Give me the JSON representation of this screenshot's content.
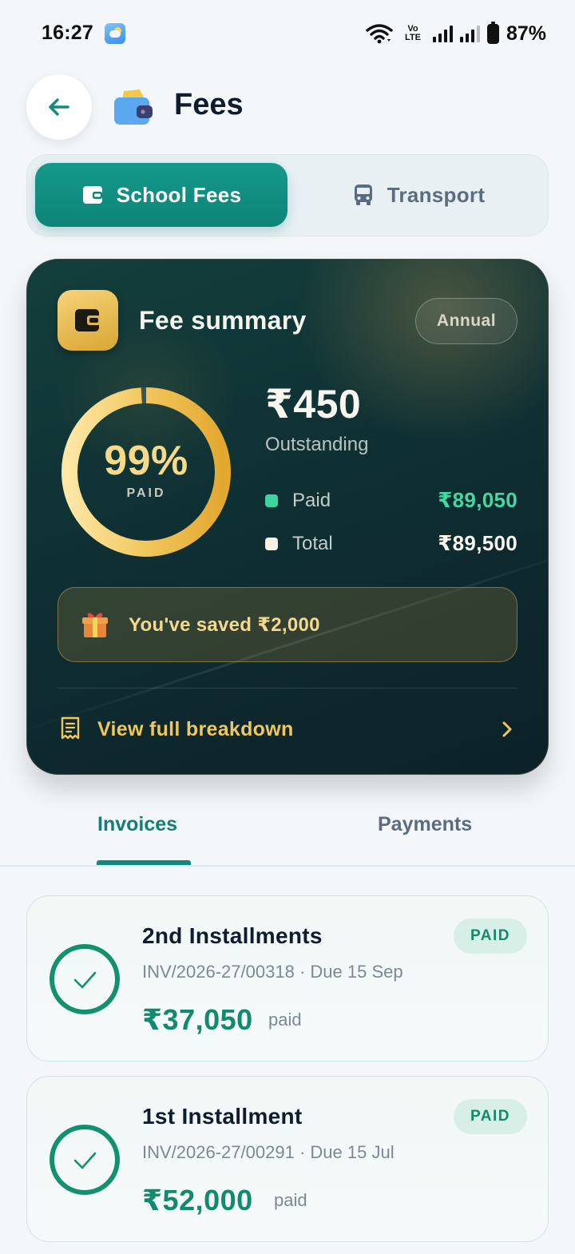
{
  "status_bar": {
    "time": "16:27",
    "network_label_top": "Vo",
    "network_label_bottom": "LTE",
    "battery": "87%"
  },
  "header": {
    "title": "Fees",
    "back_icon": "arrow-left-icon",
    "title_icon": "wallet-icon"
  },
  "segments": [
    {
      "label": "School Fees",
      "icon": "wallet-icon",
      "active": true
    },
    {
      "label": "Transport",
      "icon": "bus-icon",
      "active": false
    }
  ],
  "summary": {
    "title": "Fee summary",
    "badge": "Annual",
    "percent_text": "99%",
    "percent_label": "PAID",
    "paid_fraction": 0.99,
    "outstanding_amount": "₹450",
    "outstanding_label": "Outstanding",
    "paid_label": "Paid",
    "paid_value": "₹89,050",
    "total_label": "Total",
    "total_value": "₹89,500",
    "saved_text": "You've saved ₹2,000",
    "breakdown_label": "View full breakdown"
  },
  "tabs": [
    {
      "label": "Invoices",
      "active": true
    },
    {
      "label": "Payments",
      "active": false
    }
  ],
  "invoices": [
    {
      "title": "2nd Installments",
      "number": "INV/2026-27/00318",
      "due": "Due 15 Sep",
      "amount": "₹37,050",
      "amount_suffix": "paid",
      "status": "PAID"
    },
    {
      "title": "1st Installment",
      "number": "INV/2026-27/00291",
      "due": "Due 15 Jul",
      "amount": "₹52,000",
      "amount_suffix": "paid",
      "status": "PAID"
    }
  ],
  "colors": {
    "accent": "#0e8478",
    "gold": "#e8b84a",
    "paid_green": "#3ed3a0",
    "amount_green": "#128a6d"
  }
}
